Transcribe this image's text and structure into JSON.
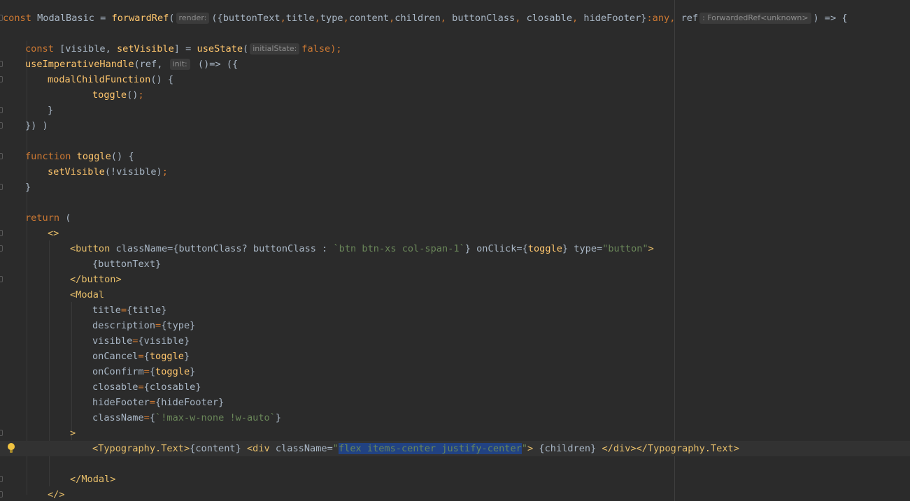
{
  "editor": {
    "language": "tsx",
    "theme": {
      "background": "#2b2b2b",
      "keyword": "#cc7832",
      "function": "#ffc66d",
      "string": "#6a8759",
      "tag": "#e8bf6a",
      "text": "#a9b7c6",
      "selection": "#214283"
    },
    "current_line": 29,
    "gutter_icons": [
      "fold-marker-icon",
      "lightbulb-icon"
    ]
  },
  "code": {
    "l1": {
      "kw_const": "const",
      "name": "ModalBasic",
      "eq": " = ",
      "fn": "forwardRef",
      "open": "(",
      "hint_render": "render:",
      "params_open": "({",
      "p_buttonText": "buttonText",
      "c1": ",",
      "p_title": "title",
      "c2": ",",
      "p_type": "type",
      "c3": ",",
      "p_content": "content",
      "c4": ",",
      "p_children": "children",
      "c5": ", ",
      "p_buttonClass": "buttonClass",
      "c6": ", ",
      "p_closable": "closable",
      "c7": ", ",
      "p_hideFooter": "hideFooter",
      "close_obj": "}",
      "colon_any": ":any",
      "c8": ", ",
      "p_ref": "ref",
      "hint_ref_type": ": ForwardedRef<unknown>",
      "arrow": ") => {"
    },
    "l3": {
      "kw_const": "const",
      "destr": " [visible, ",
      "setter": "setVisible",
      "eq": "] = ",
      "fn": "useState",
      "open": "(",
      "hint": "initialState:",
      "val": "false",
      "close": ");"
    },
    "l4": {
      "fn": "useImperativeHandle",
      "open": "(ref, ",
      "hint": "init:",
      "arrow": " ()=> ({"
    },
    "l5": {
      "fn": "modalChildFunction",
      "rest": "() {"
    },
    "l6": {
      "fn": "toggle",
      "rest": "()",
      "semi": ";"
    },
    "l7": {
      "text": "}"
    },
    "l8": {
      "text": "}) )"
    },
    "l10": {
      "kw": "function",
      "fn": "toggle",
      "rest": "() {"
    },
    "l11": {
      "fn": "setVisible",
      "rest": "(!visible)",
      "semi": ";"
    },
    "l12": {
      "text": "}"
    },
    "l14": {
      "kw": "return",
      "rest": " ("
    },
    "l15": {
      "tag": "<>"
    },
    "l16": {
      "tag_open": "<button",
      "attr1": " className",
      "eq1": "=",
      "expr1a": "{buttonClass? buttonClass : ",
      "str1": "`btn btn-xs col-span-1`",
      "expr1b": "}",
      "attr2": " onClick",
      "eq2": "=",
      "b2o": "{",
      "val2": "toggle",
      "b2c": "}",
      "attr3": " type",
      "eq3": "=",
      "str3": "\"button\"",
      "gt": ">"
    },
    "l17": {
      "expr": "{buttonText}"
    },
    "l18": {
      "tag": "</button>"
    },
    "l19": {
      "tag": "<Modal"
    },
    "props": [
      {
        "name": "title",
        "eq": "=",
        "open": "{",
        "value": "title",
        "close": "}",
        "fn": false
      },
      {
        "name": "description",
        "eq": "=",
        "open": "{",
        "value": "type",
        "close": "}",
        "fn": false
      },
      {
        "name": "visible",
        "eq": "=",
        "open": "{",
        "value": "visible",
        "close": "}",
        "fn": false
      },
      {
        "name": "onCancel",
        "eq": "=",
        "open": "{",
        "value": "toggle",
        "close": "}",
        "fn": true
      },
      {
        "name": "onConfirm",
        "eq": "=",
        "open": "{",
        "value": "toggle",
        "close": "}",
        "fn": true
      },
      {
        "name": "closable",
        "eq": "=",
        "open": "{",
        "value": "closable",
        "close": "}",
        "fn": false
      },
      {
        "name": "hideFooter",
        "eq": "=",
        "open": "{",
        "value": "hideFooter",
        "close": "}",
        "fn": false
      },
      {
        "name": "className",
        "eq": "=",
        "open": "{",
        "value": "`!max-w-none !w-auto`",
        "close": "}",
        "fn": false
      }
    ],
    "l28": {
      "tag": ">"
    },
    "l29": {
      "tag_typo": "<Typography.Text>",
      "expr_content": "{content} ",
      "tag_div": "<div",
      "attr": " className",
      "eq": "=",
      "q1": "\"",
      "selected": "flex items-center justify-center",
      "q2": "\"",
      "gt": ">",
      "expr_children": " {children} ",
      "close_div": "</div>",
      "close_typo": "</Typography.Text>"
    },
    "l31": {
      "tag": "</Modal>"
    },
    "l32": {
      "tag": "</>"
    }
  }
}
